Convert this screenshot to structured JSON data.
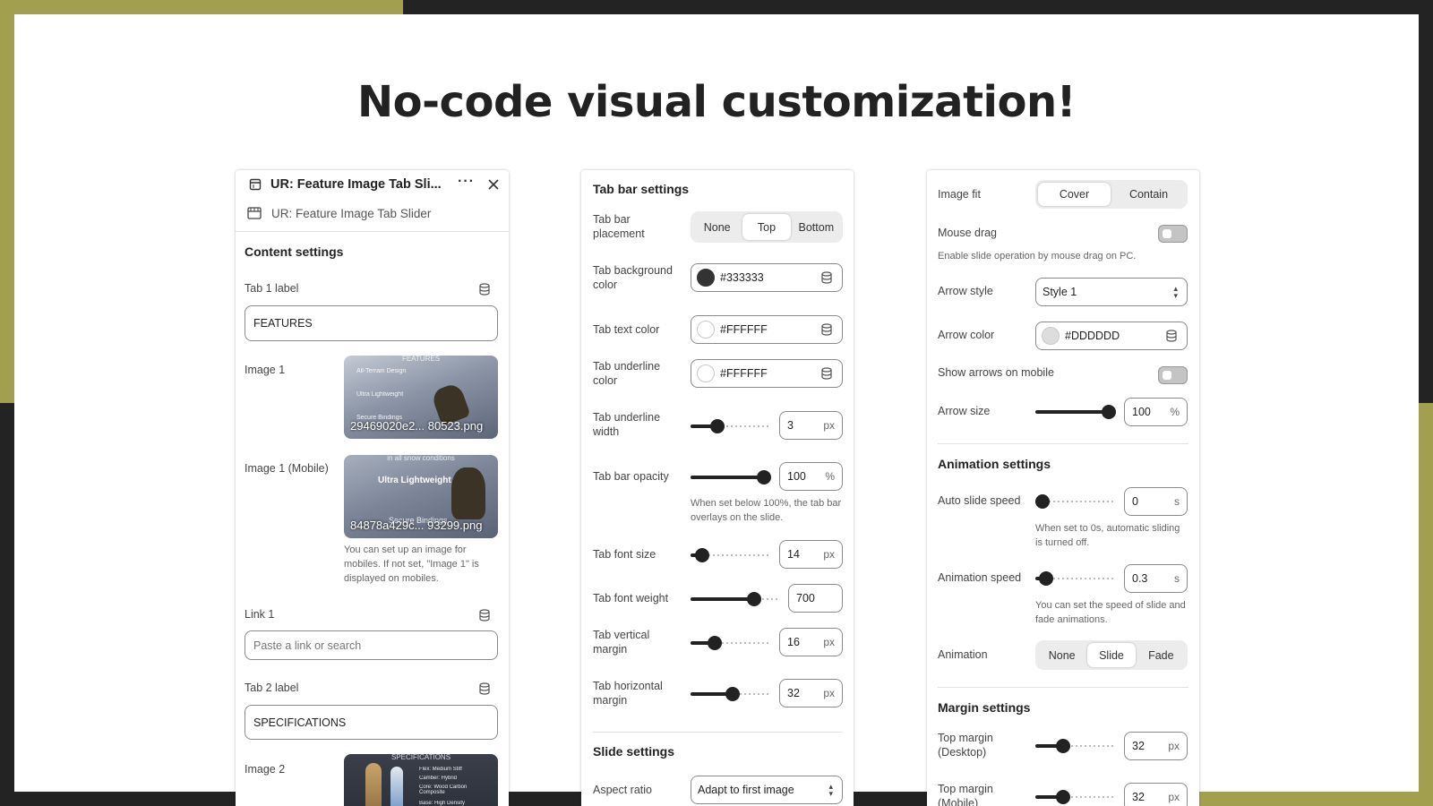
{
  "headline": "No-code visual customization!",
  "colors": {
    "accent": "#a2a04f",
    "frame": "#232323"
  },
  "left_panel": {
    "app_title": "UR: Feature Image Tab Sli...",
    "block_name": "UR: Feature Image Tab Slider",
    "section": "Content settings",
    "tab1_label": "Tab 1 label",
    "tab1_value": "FEATURES",
    "image1_label": "Image 1",
    "image1_file": "29469020e2... 80523.png",
    "image1_caption": "FEATURES",
    "image1_items": [
      "All-Terrain Design",
      "Ultra Lightweight",
      "Secure Bindings"
    ],
    "image1m_label": "Image 1 (Mobile)",
    "image1m_file": "84878a429c... 93299.png",
    "image1m_caption": "in all snow conditions",
    "image1m_items": [
      "Ultra Lightweight",
      "Secure Bindings"
    ],
    "image1m_hint": "You can set up an image for mobiles. If not set, \"Image 1\" is displayed on mobiles.",
    "link1_label": "Link 1",
    "link1_placeholder": "Paste a link or search",
    "tab2_label": "Tab 2 label",
    "tab2_value": "SPECIFICATIONS",
    "image2_label": "Image 2",
    "image2_caption": "SPECIFICATIONS",
    "image2_items": [
      "Flex: Medium Stiff",
      "Camber: Hybrid",
      "Core: Wood Carbon Composite",
      "Base: High Density"
    ]
  },
  "mid_panel": {
    "section": "Tab bar settings",
    "placement_label": "Tab bar placement",
    "placement_options": [
      "None",
      "Top",
      "Bottom"
    ],
    "placement_selected": "Top",
    "bg_label": "Tab background color",
    "bg_value": "#333333",
    "text_label": "Tab text color",
    "text_value": "#FFFFFF",
    "ul_label": "Tab underline color",
    "ul_value": "#FFFFFF",
    "ulw_label": "Tab underline width",
    "ulw_value": "3",
    "ulw_unit": "px",
    "op_label": "Tab bar opacity",
    "op_value": "100",
    "op_unit": "%",
    "op_hint": "When set below 100%, the tab bar overlays on the slide.",
    "fs_label": "Tab font size",
    "fs_value": "14",
    "fs_unit": "px",
    "fw_label": "Tab font weight",
    "fw_value": "700",
    "vm_label": "Tab vertical margin",
    "vm_value": "16",
    "vm_unit": "px",
    "hm_label": "Tab horizontal margin",
    "hm_value": "32",
    "hm_unit": "px",
    "section2": "Slide settings",
    "aspect_label": "Aspect ratio",
    "aspect_value": "Adapt to first image"
  },
  "right_panel": {
    "fit_label": "Image fit",
    "fit_options": [
      "Cover",
      "Contain"
    ],
    "fit_selected": "Cover",
    "drag_label": "Mouse drag",
    "drag_on": false,
    "drag_hint": "Enable slide operation by mouse drag on PC.",
    "arrow_style_label": "Arrow style",
    "arrow_style_value": "Style 1",
    "arrow_color_label": "Arrow color",
    "arrow_color_value": "#DDDDDD",
    "mobile_arrows_label": "Show arrows on mobile",
    "mobile_arrows_on": false,
    "arrow_size_label": "Arrow size",
    "arrow_size_value": "100",
    "arrow_size_unit": "%",
    "section_anim": "Animation settings",
    "auto_label": "Auto slide speed",
    "auto_value": "0",
    "auto_unit": "s",
    "auto_hint": "When set to 0s, automatic sliding is turned off.",
    "anim_speed_label": "Animation speed",
    "anim_speed_value": "0.3",
    "anim_speed_unit": "s",
    "anim_speed_hint": "You can set the speed of slide and fade animations.",
    "anim_label": "Animation",
    "anim_options": [
      "None",
      "Slide",
      "Fade"
    ],
    "anim_selected": "Slide",
    "section_margin": "Margin settings",
    "top_desktop_label": "Top margin (Desktop)",
    "top_desktop_value": "32",
    "top_desktop_unit": "px",
    "top_mobile_label": "Top margin (Mobile)",
    "top_mobile_value": "32",
    "top_mobile_unit": "px"
  }
}
